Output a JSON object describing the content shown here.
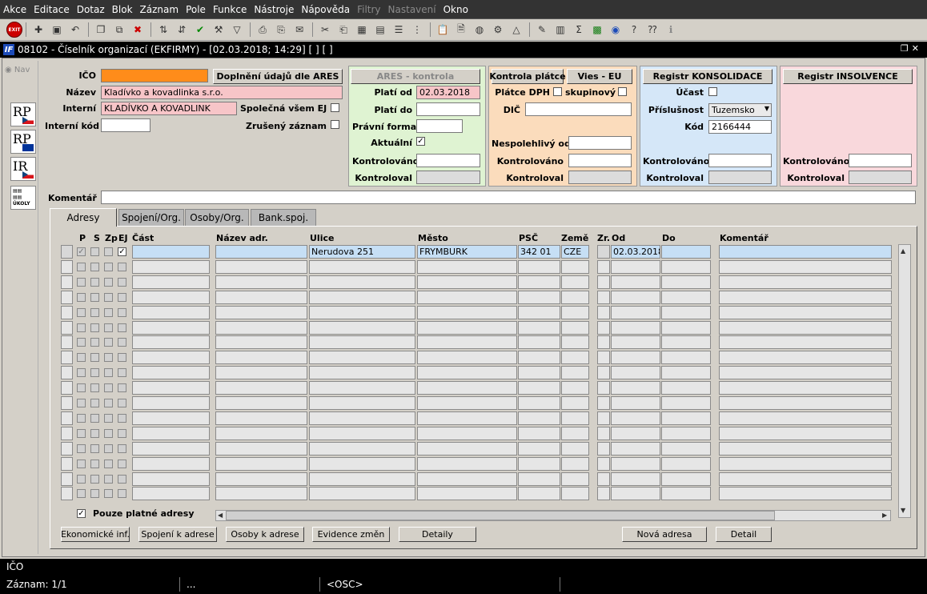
{
  "menu": [
    "Akce",
    "Editace",
    "Dotaz",
    "Blok",
    "Záznam",
    "Pole",
    "Funkce",
    "Nástroje",
    "Nápověda"
  ],
  "menu_disabled": [
    "Filtry",
    "Nastavení"
  ],
  "menu_last": "Okno",
  "toolbar": {
    "exit_label": "EXIT"
  },
  "window": {
    "title": "08102 - Číselník organizací (EKFIRMY) - [02.03.2018; 14:29]  [ ] [ ]"
  },
  "side": {
    "nav": "Nav",
    "rp": "RP",
    "ir": "IR",
    "ukoly": "ÚKOLY"
  },
  "form": {
    "ico_label": "IČO",
    "ico_value": "",
    "nazev_label": "Název",
    "nazev_value": "Kladívko a kovadlinka s.r.o.",
    "interni_label": "Interní",
    "interni_value": "KLADÍVKO A KOVADLINK",
    "interni_kod_label": "Interní kód",
    "interni_kod_value": "",
    "doplneni_button": "Doplnění údajů dle ARES",
    "spolecna_label": "Společná všem EJ",
    "zruseny_label": "Zrušený záznam",
    "komentar_label": "Komentář",
    "komentar_value": ""
  },
  "ares": {
    "button": "ARES - kontrola",
    "plati_od_label": "Platí od",
    "plati_od_value": "02.03.2018",
    "plati_do_label": "Platí do",
    "plati_do_value": "",
    "pravni_forma_label": "Právní forma",
    "pravni_forma_value": "",
    "aktualni_label": "Aktuální",
    "kontrolovano_label": "Kontrolováno",
    "kontrolovano_value": "",
    "kontroloval_label": "Kontroloval",
    "kontroloval_value": ""
  },
  "platce": {
    "button": "Kontrola plátce",
    "vies_button": "Vies - EU",
    "platce_dph_label": "Plátce DPH",
    "skupinovy_label": "skupinový",
    "dic_label": "DIČ",
    "dic_value": "",
    "nespolehlivy_label": "Nespolehlivý od",
    "nespolehlivy_value": "",
    "kontrolovano_label": "Kontrolováno",
    "kontrolovano_value": "",
    "kontroloval_label": "Kontroloval",
    "kontroloval_value": ""
  },
  "konsolidace": {
    "button": "Registr KONSOLIDACE",
    "ucast_label": "Účast",
    "prislusnost_label": "Příslušnost",
    "prislusnost_value": "Tuzemsko",
    "kod_label": "Kód",
    "kod_value": "2166444",
    "kontrolovano_label": "Kontrolováno",
    "kontrolovano_value": "",
    "kontroloval_label": "Kontroloval",
    "kontroloval_value": ""
  },
  "insolvence": {
    "button": "Registr INSOLVENCE",
    "kontrolovano_label": "Kontrolováno",
    "kontrolovano_value": "",
    "kontroloval_label": "Kontroloval",
    "kontroloval_value": ""
  },
  "tabs": [
    "Adresy",
    "Spojení/Org.",
    "Osoby/Org.",
    "Bank.spoj."
  ],
  "grid": {
    "headers": {
      "p": "P",
      "s": "S",
      "zp": "Zp",
      "ej": "EJ",
      "cast": "Část",
      "nazev_adr": "Název adr.",
      "ulice": "Ulice",
      "mesto": "Město",
      "psc": "PSČ",
      "zeme": "Země",
      "zr": "Zr.",
      "od": "Od",
      "do": "Do",
      "komentar": "Komentář"
    },
    "rows": [
      {
        "cast": "",
        "nazev_adr": "",
        "ulice": "Nerudova 251",
        "mesto": "FRYMBURK",
        "psc": "342 01",
        "zeme": "CZE",
        "od": "02.03.2018",
        "do": "",
        "komentar": ""
      }
    ],
    "visible_rows": 17
  },
  "pouze_platne_label": "Pouze platné adresy",
  "bottom_buttons": {
    "ekonomicke": "Ekonomické inf.",
    "spojeni": "Spojení k adrese",
    "osoby": "Osoby k adrese",
    "evidence": "Evidence změn",
    "detaily": "Detaily",
    "nova_adresa": "Nová adresa",
    "detail": "Detail"
  },
  "status": {
    "field": "IČO",
    "zaznam": "Záznam: 1/1",
    "dots": "...",
    "osc": "<OSC>"
  },
  "colors": {
    "required": "#ff8c1a",
    "pink": "#f7c5c8",
    "ares_panel": "#dff3d2",
    "platce_panel": "#fbdcbc",
    "konsolidace_panel": "#d5e7f8",
    "insolvence_panel": "#f9d8dc",
    "selected_row": "#c6dff5"
  }
}
